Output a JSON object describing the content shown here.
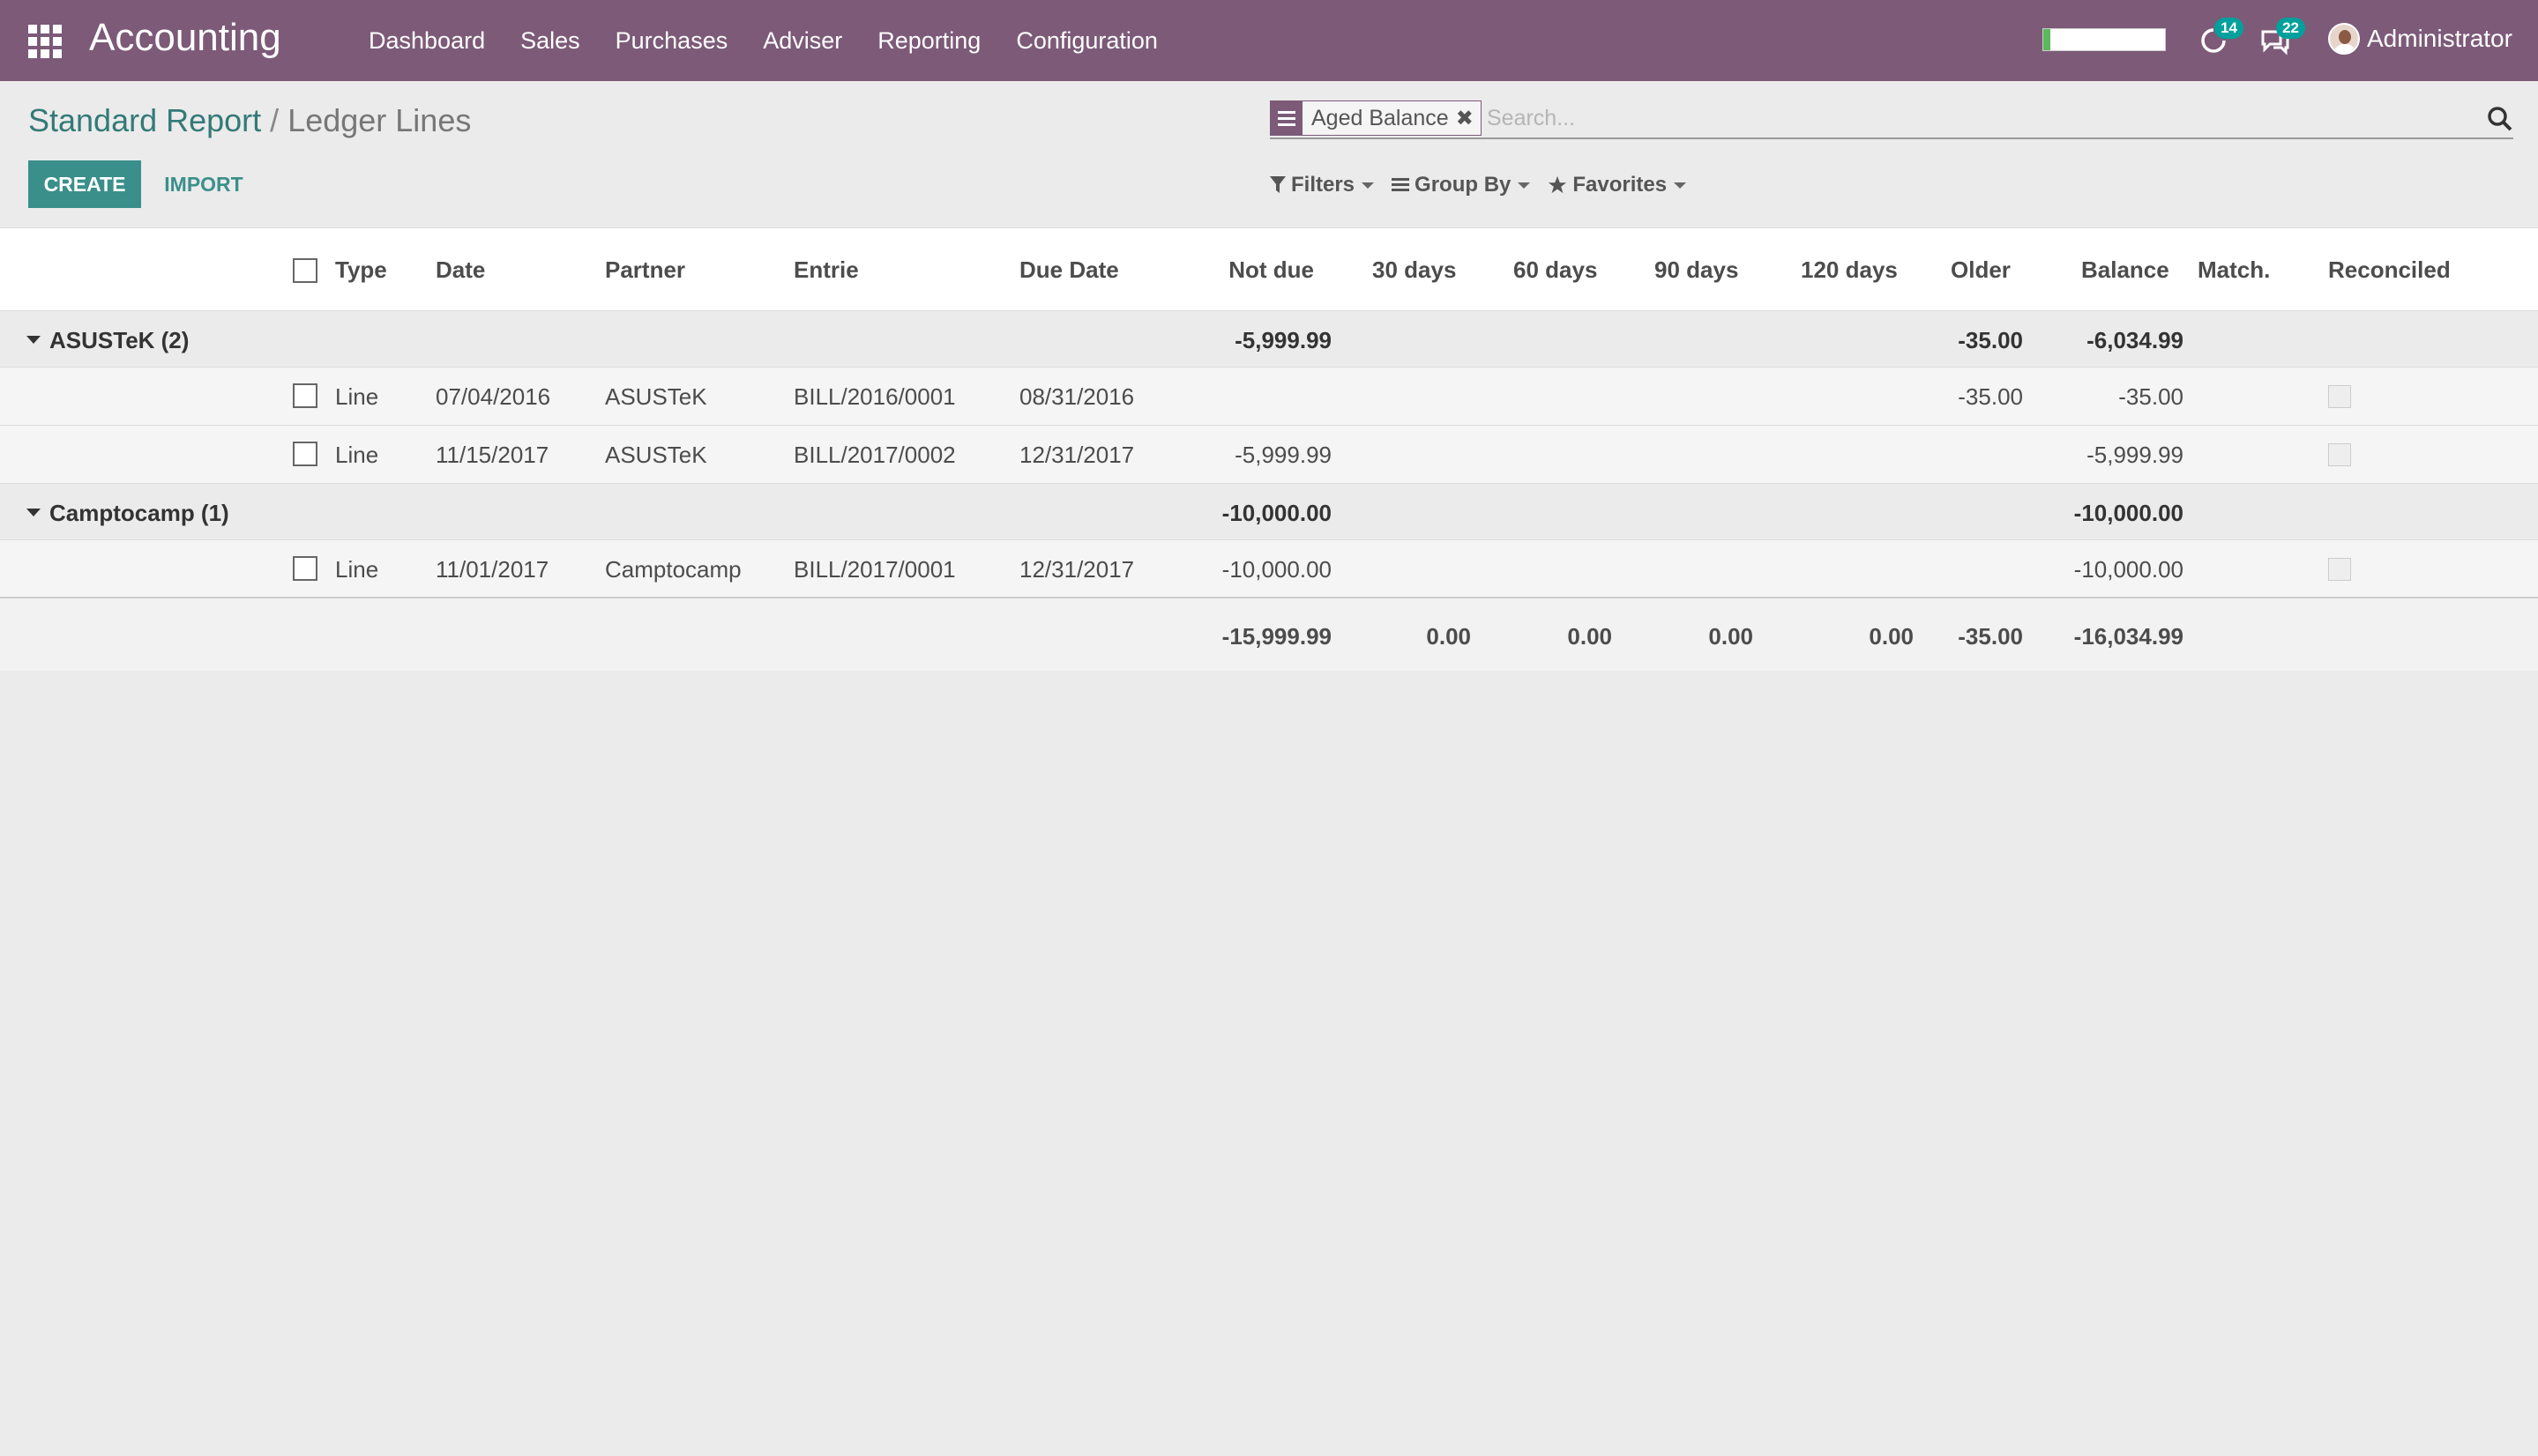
{
  "app": {
    "brand": "Accounting",
    "menu": [
      "Dashboard",
      "Sales",
      "Purchases",
      "Adviser",
      "Reporting",
      "Configuration"
    ],
    "activity_badge": "14",
    "messages_badge": "22",
    "user": "Administrator"
  },
  "breadcrumb": {
    "parent": "Standard Report",
    "separator": "/",
    "current": "Ledger Lines"
  },
  "buttons": {
    "create": "CREATE",
    "import": "IMPORT"
  },
  "search": {
    "facet": "Aged Balance",
    "facet_remove": "✖",
    "placeholder": "Search..."
  },
  "filters": {
    "filters": "Filters",
    "group_by": "Group By",
    "favorites": "Favorites"
  },
  "table": {
    "headers": {
      "type": "Type",
      "date": "Date",
      "partner": "Partner",
      "entrie": "Entrie",
      "due_date": "Due Date",
      "not_due": "Not due",
      "d30": "30 days",
      "d60": "60 days",
      "d90": "90 days",
      "d120": "120 days",
      "older": "Older",
      "balance": "Balance",
      "match": "Match.",
      "reconciled": "Reconciled"
    },
    "groups": [
      {
        "label": "ASUSTeK (2)",
        "not_due": "-5,999.99",
        "older": "-35.00",
        "balance": "-6,034.99",
        "rows": [
          {
            "type": "Line",
            "date": "07/04/2016",
            "partner": "ASUSTeK",
            "entrie": "BILL/2016/0001",
            "due_date": "08/31/2016",
            "not_due": "",
            "older": "-35.00",
            "balance": "-35.00"
          },
          {
            "type": "Line",
            "date": "11/15/2017",
            "partner": "ASUSTeK",
            "entrie": "BILL/2017/0002",
            "due_date": "12/31/2017",
            "not_due": "-5,999.99",
            "older": "",
            "balance": "-5,999.99"
          }
        ]
      },
      {
        "label": "Camptocamp (1)",
        "not_due": "-10,000.00",
        "older": "",
        "balance": "-10,000.00",
        "rows": [
          {
            "type": "Line",
            "date": "11/01/2017",
            "partner": "Camptocamp",
            "entrie": "BILL/2017/0001",
            "due_date": "12/31/2017",
            "not_due": "-10,000.00",
            "older": "",
            "balance": "-10,000.00"
          }
        ]
      }
    ],
    "totals": {
      "not_due": "-15,999.99",
      "d30": "0.00",
      "d60": "0.00",
      "d90": "0.00",
      "d120": "0.00",
      "older": "-35.00",
      "balance": "-16,034.99"
    }
  },
  "colors": {
    "navbar": "#7c5a78",
    "primary": "#3b8f8b",
    "badge": "#00a09d"
  }
}
